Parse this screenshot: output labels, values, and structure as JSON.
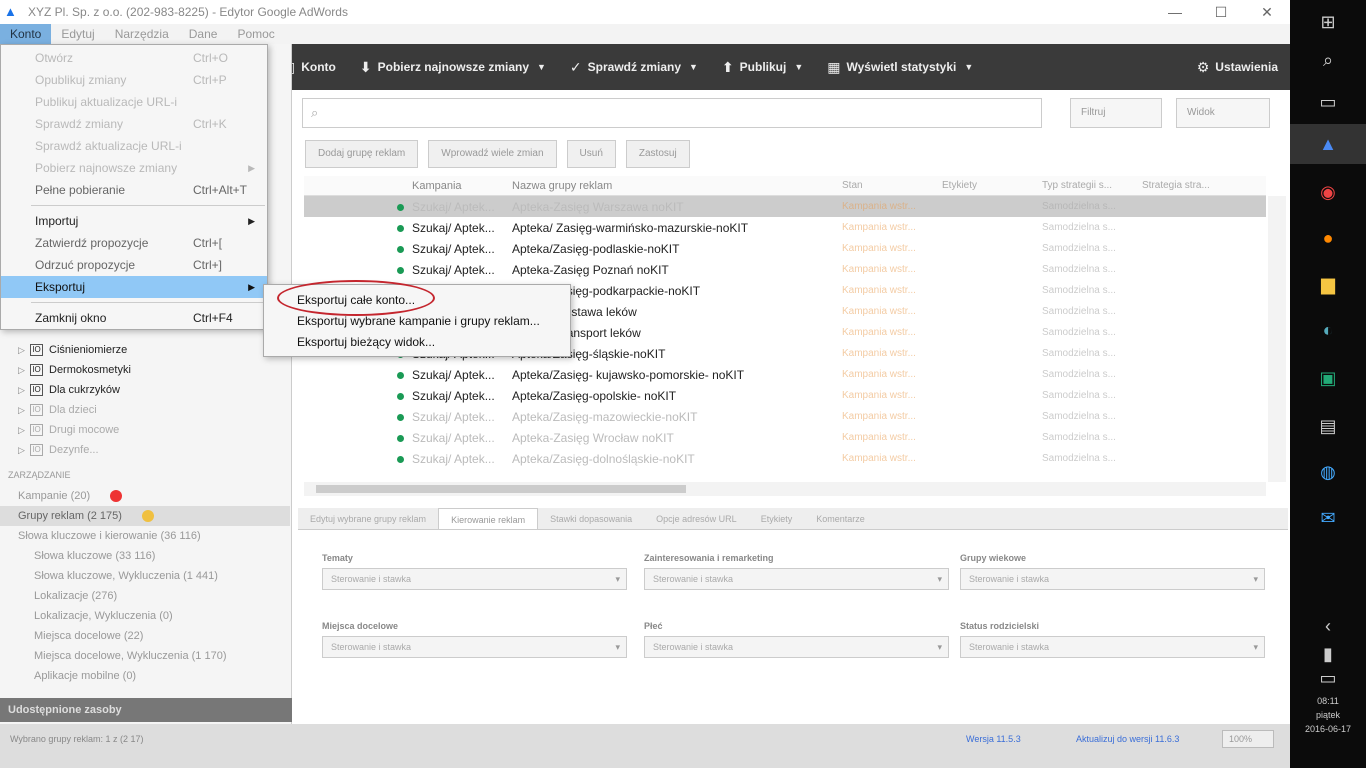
{
  "window": {
    "title": "XYZ Pl. Sp. z o.o. (202-983-8225) - Edytor Google AdWords",
    "minimize": "—",
    "maximize": "☐",
    "close": "✕"
  },
  "menubar": [
    "Konto",
    "Edytuj",
    "Narzędzia",
    "Dane",
    "Pomoc"
  ],
  "menu": {
    "items": [
      {
        "label": "Otwórz",
        "shortcut": "Ctrl+O",
        "state": "disabled"
      },
      {
        "label": "Opublikuj zmiany",
        "shortcut": "Ctrl+P",
        "state": "disabled"
      },
      {
        "label": "Publikuj aktualizacje URL-i",
        "shortcut": "",
        "state": "disabled"
      },
      {
        "label": "Sprawdź zmiany",
        "shortcut": "Ctrl+K",
        "state": "disabled"
      },
      {
        "label": "Sprawdź aktualizacje URL-i",
        "shortcut": "",
        "state": "disabled"
      },
      {
        "label": "Pobierz najnowsze zmiany",
        "shortcut": "",
        "state": "disabled",
        "submenu": true
      },
      {
        "label": "Pełne pobieranie",
        "shortcut": "Ctrl+Alt+T",
        "state": "dim"
      },
      {
        "label": "Importuj",
        "shortcut": "",
        "state": "normal",
        "submenu": true
      },
      {
        "label": "Zatwierdź propozycje",
        "shortcut": "Ctrl+[",
        "state": "dim"
      },
      {
        "label": "Odrzuć propozycje",
        "shortcut": "Ctrl+]",
        "state": "dim"
      },
      {
        "label": "Eksportuj",
        "shortcut": "",
        "state": "highlighted",
        "submenu": true
      },
      {
        "label": "Zamknij okno",
        "shortcut": "Ctrl+F4",
        "state": "normal"
      }
    ]
  },
  "submenu": {
    "items": [
      "Eksportuj całe konto...",
      "Eksportuj wybrane kampanie i grupy reklam...",
      "Eksportuj bieżący widok..."
    ]
  },
  "toolbar": {
    "konto": "Konto",
    "pobierz": "Pobierz najnowsze zmiany",
    "sprawdz": "Sprawdź zmiany",
    "publikuj": "Publikuj",
    "statystyki": "Wyświetl statystyki",
    "ustawienia": "Ustawienia"
  },
  "search": {
    "placeholder": "",
    "filter_label": "Filtruj",
    "view_label": "Widok"
  },
  "actions": [
    "Dodaj grupę reklam",
    "Wprowadź wiele zmian",
    "Usuń",
    "Zastosuj"
  ],
  "grid": {
    "headers": [
      "",
      "",
      "",
      "",
      "Kampania",
      "Nazwa grupy reklam",
      "Stan",
      "Etykiety",
      "Typ strategii s...",
      "Strategia stra..."
    ],
    "rows": [
      {
        "campaign": "Szukaj/ Aptek...",
        "group": "Apteka-Zasięg Warszawa noKIT",
        "faded": true
      },
      {
        "campaign": "Szukaj/ Aptek...",
        "group": "Apteka/ Zasięg-warmińsko-mazurskie-noKIT",
        "faded": false
      },
      {
        "campaign": "Szukaj/ Aptek...",
        "group": "Apteka/Zasięg-podlaskie-noKIT",
        "faded": false
      },
      {
        "campaign": "Szukaj/ Aptek...",
        "group": "Apteka-Zasięg Poznań noKIT",
        "faded": false
      },
      {
        "campaign": "Szukaj/ Aptek...",
        "group": "Apteka/Zasięg-podkarpackie-noKIT",
        "faded": false
      },
      {
        "campaign": "Szukaj/ Aptek...",
        "group": "Apteka/ Dostawa leków",
        "faded": false
      },
      {
        "campaign": "Szukaj/ Aptek...",
        "group": "Apteka/ Transport leków",
        "faded": false
      },
      {
        "campaign": "Szukaj/ Aptek...",
        "group": "Apteka/Zasięg-śląskie-noKIT",
        "faded": false
      },
      {
        "campaign": "Szukaj/ Aptek...",
        "group": "Apteka/Zasięg- kujawsko-pomorskie- noKIT",
        "faded": false
      },
      {
        "campaign": "Szukaj/ Aptek...",
        "group": "Apteka/Zasięg-opolskie- noKIT",
        "faded": false
      },
      {
        "campaign": "Szukaj/ Aptek...",
        "group": "Apteka/Zasięg-mazowieckie-noKIT",
        "faded": true
      },
      {
        "campaign": "Szukaj/ Aptek...",
        "group": "Apteka-Zasięg Wrocław noKIT",
        "faded": true
      },
      {
        "campaign": "Szukaj/ Aptek...",
        "group": "Apteka/Zasięg-dolnośląskie-noKIT",
        "faded": true
      }
    ],
    "stan": "Kampania wstr...",
    "typ": "Samodzielna s..."
  },
  "tree": [
    {
      "label": "Ciśnieniomierze",
      "faded": false
    },
    {
      "label": "Dermokosmetyki",
      "faded": false
    },
    {
      "label": "Dla cukrzyków",
      "faded": false
    },
    {
      "label": "Dla dzieci",
      "faded": true
    },
    {
      "label": "Drugi mocowe",
      "faded": true
    },
    {
      "label": "Dezynfe...",
      "faded": true
    }
  ],
  "lowerleft": {
    "header": "ZARZĄDZANIE",
    "rows": [
      {
        "label": "Kampanie (20)",
        "type": "red"
      },
      {
        "label": "Grupy reklam (2 175)",
        "type": "sel"
      },
      {
        "label": "Słowa kluczowe i kierowanie (36 116)",
        "type": "plain"
      },
      {
        "label": "Słowa kluczowe (33 116)",
        "type": "indent"
      },
      {
        "label": "Słowa kluczowe, Wykluczenia (1 441)",
        "type": "indent"
      },
      {
        "label": "Lokalizacje (276)",
        "type": "indent"
      },
      {
        "label": "Lokalizacje, Wykluczenia (0)",
        "type": "indent"
      },
      {
        "label": "Miejsca docelowe (22)",
        "type": "indent"
      },
      {
        "label": "Miejsca docelowe, Wykluczenia (1 170)",
        "type": "indent"
      },
      {
        "label": "Aplikacje mobilne (0)",
        "type": "indent"
      }
    ],
    "footer": "Udostępnione zasoby"
  },
  "bottomtabs": [
    "Edytuj wybrane grupy reklam",
    "Kierowanie reklam",
    "Stawki dopasowania",
    "Opcje adresów URL",
    "Etykiety",
    "Komentarze"
  ],
  "forms": [
    {
      "label": "Tematy",
      "value": "Sterowanie i stawka"
    },
    {
      "label": "Zainteresowania i remarketing",
      "value": "Sterowanie i stawka"
    },
    {
      "label": "Grupy wiekowe",
      "value": "Sterowanie i stawka"
    },
    {
      "label": "Miejsca docelowe",
      "value": "Sterowanie i stawka"
    },
    {
      "label": "Płeć",
      "value": "Sterowanie i stawka"
    },
    {
      "label": "Status rodzicielski",
      "value": "Sterowanie i stawka"
    }
  ],
  "statusbar": {
    "text": "Wybrano grupy reklam: 1 z (2 17)",
    "link1": "Wersja 11.5.3",
    "link2": "Aktualizuj do wersji 11.6.3",
    "zoom": "100%"
  },
  "clock": {
    "time": "08:11",
    "date": "2016-06-17",
    "day": "piątek"
  },
  "colors": {
    "accent": "#90c8f6",
    "toolbar": "#3a3a3a",
    "status_green": "#1a9a55",
    "annotation": "#c4262e"
  }
}
